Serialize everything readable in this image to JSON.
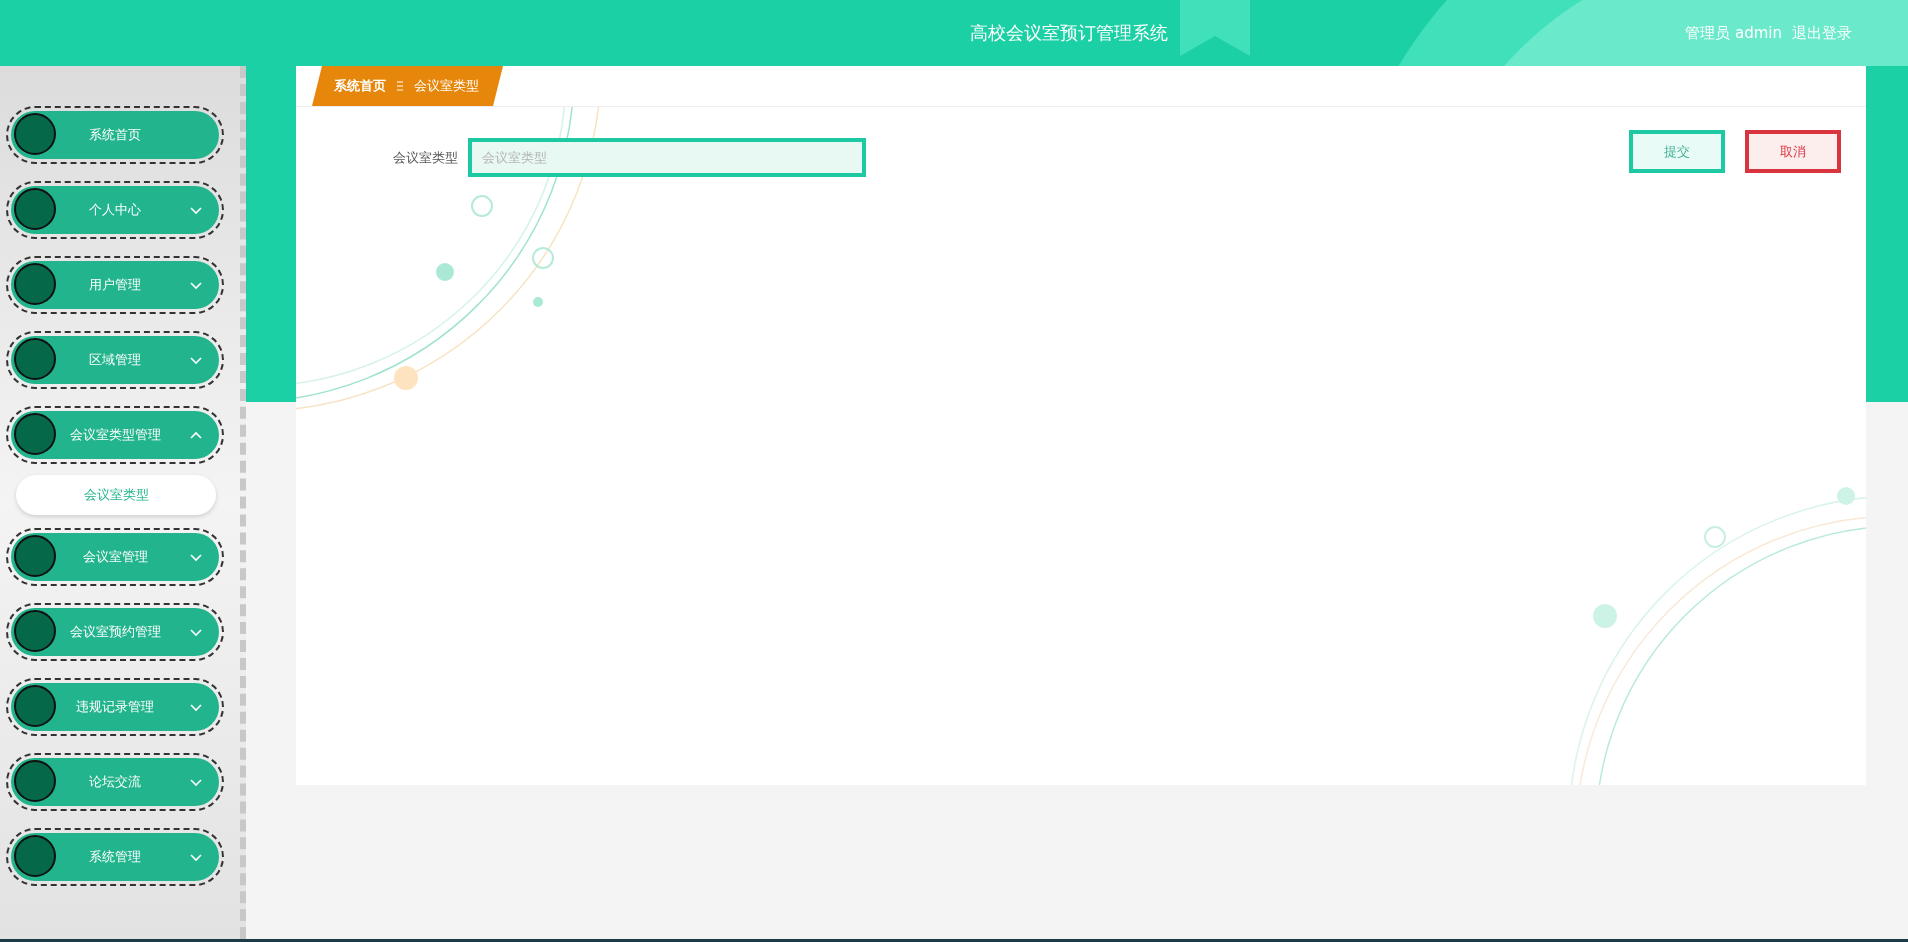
{
  "header": {
    "title": "高校会议室预订管理系统",
    "user": "管理员 admin",
    "logout": "退出登录"
  },
  "sidebar": {
    "items": [
      {
        "label": "系统首页",
        "kind": "link"
      },
      {
        "label": "个人中心",
        "kind": "menu",
        "expanded": false
      },
      {
        "label": "用户管理",
        "kind": "menu",
        "expanded": false
      },
      {
        "label": "区域管理",
        "kind": "menu",
        "expanded": false
      },
      {
        "label": "会议室类型管理",
        "kind": "menu",
        "expanded": true,
        "children": [
          {
            "label": "会议室类型",
            "selected": true
          }
        ]
      },
      {
        "label": "会议室管理",
        "kind": "menu",
        "expanded": false
      },
      {
        "label": "会议室预约管理",
        "kind": "menu",
        "expanded": false
      },
      {
        "label": "违规记录管理",
        "kind": "menu",
        "expanded": false
      },
      {
        "label": "论坛交流",
        "kind": "menu",
        "expanded": false
      },
      {
        "label": "系统管理",
        "kind": "menu",
        "expanded": false
      }
    ]
  },
  "breadcrumb": [
    "系统首页",
    "会议室类型"
  ],
  "form": {
    "label": "会议室类型",
    "placeholder": "会议室类型"
  },
  "buttons": [
    {
      "label": "提交",
      "kind": "submit"
    },
    {
      "label": "取消",
      "kind": "cancel"
    }
  ]
}
